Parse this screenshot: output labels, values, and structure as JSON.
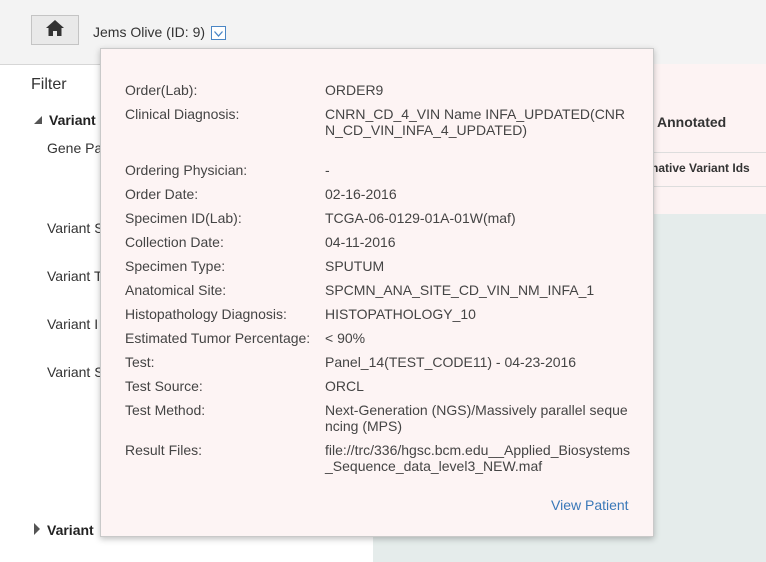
{
  "header": {
    "patient_label": "Jems Olive (ID: 9)"
  },
  "filter": {
    "title": "Filter",
    "section_open": "Variant",
    "section_closed": "Variant",
    "items": [
      "Gene Pa",
      "Variant S",
      "Variant T",
      "Variant I",
      "Variant S"
    ]
  },
  "results": {
    "column_title": "Annotated",
    "column_sub": "native Variant Ids"
  },
  "popover": {
    "rows": [
      {
        "label": "Order(Lab):",
        "value": "ORDER9"
      },
      {
        "label": "Clinical Diagnosis:",
        "value": "CNRN_CD_4_VIN Name INFA_UPDATED(CNRN_CD_VIN_INFA_4_UPDATED)"
      },
      {
        "label": "Ordering Physician:",
        "value": "-"
      },
      {
        "label": "Order Date:",
        "value": "02-16-2016"
      },
      {
        "label": "Specimen ID(Lab):",
        "value": "TCGA-06-0129-01A-01W(maf)"
      },
      {
        "label": "Collection Date:",
        "value": "04-11-2016"
      },
      {
        "label": "Specimen Type:",
        "value": "SPUTUM"
      },
      {
        "label": "Anatomical Site:",
        "value": "SPCMN_ANA_SITE_CD_VIN_NM_INFA_1"
      },
      {
        "label": "Histopathology Diagnosis:",
        "value": "HISTOPATHOLOGY_10"
      },
      {
        "label": "Estimated Tumor Percentage:",
        "value": "< 90%"
      },
      {
        "label": "Test:",
        "value": "Panel_14(TEST_CODE11) - 04-23-2016"
      },
      {
        "label": "Test Source:",
        "value": "ORCL"
      },
      {
        "label": "Test Method:",
        "value": "Next-Generation (NGS)/Massively parallel sequencing (MPS)"
      },
      {
        "label": "Result Files:",
        "value": "file://trc/336/hgsc.bcm.edu__Applied_Biosystems_Sequence_data_level3_NEW.maf"
      }
    ],
    "view_patient_label": "View Patient"
  },
  "colors": {
    "link": "#3a78b8",
    "popover_bg": "#fdf4f4",
    "panel_bg": "#e5eceb"
  },
  "icons": {
    "home": "home-icon",
    "dropdown": "chevron-down-icon",
    "expanded": "triangle-down-icon",
    "collapsed": "triangle-right-icon"
  }
}
